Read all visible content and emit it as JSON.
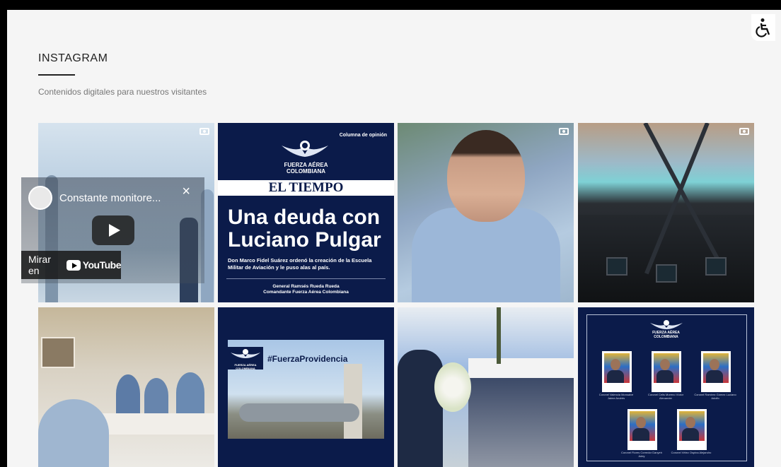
{
  "section": {
    "title": "INSTAGRAM",
    "subtitle": "Contenidos digitales para nuestros visitantes"
  },
  "accessibility": {
    "icon": "wheelchair-icon"
  },
  "posts": [
    {
      "id": "p1",
      "type": "video"
    },
    {
      "id": "p2",
      "type": "image",
      "column": "Columna de opinión",
      "brand_line1": "FUERZA AÉREA",
      "brand_line2": "COLOMBIANA",
      "newspaper": "EL TIEMPO",
      "headline_line1": "Una deuda con",
      "headline_line2": "Luciano Pulgar",
      "lede": "Don Marco Fidel Suárez ordenó la creación de la Escuela Militar de Aviación y le puso alas al país.",
      "author": "General Ramsés Rueda Rueda",
      "author_role": "Comandante Fuerza Aérea Colombiana"
    },
    {
      "id": "p3",
      "type": "video"
    },
    {
      "id": "p4",
      "type": "video"
    },
    {
      "id": "p5",
      "type": "image"
    },
    {
      "id": "p6",
      "type": "image",
      "brand_line1": "FUERZA AÉREA",
      "brand_line2": "COLOMBIANA",
      "hashtag": "#FuerzaProvidencia"
    },
    {
      "id": "p7",
      "type": "image"
    },
    {
      "id": "p8",
      "type": "image",
      "brand_line1": "FUERZA AÉREA",
      "brand_line2": "COLOMBIANA",
      "portraits": [
        "Coronel Valencia Monsalve Jaime Andrés",
        "Coronel Celis Moreno Víctor Alexander",
        "Coronel Ramírez Gómez Luciano Adolfo",
        "Coronel Flores Corredor Danyeh Adey",
        "Coronel Vélez Ospina Alejandro"
      ]
    }
  ],
  "video_overlay": {
    "title": "Constante monitore...",
    "close_label": "×",
    "watch_label": "Mirar en",
    "youtube_label": "YouTube"
  }
}
